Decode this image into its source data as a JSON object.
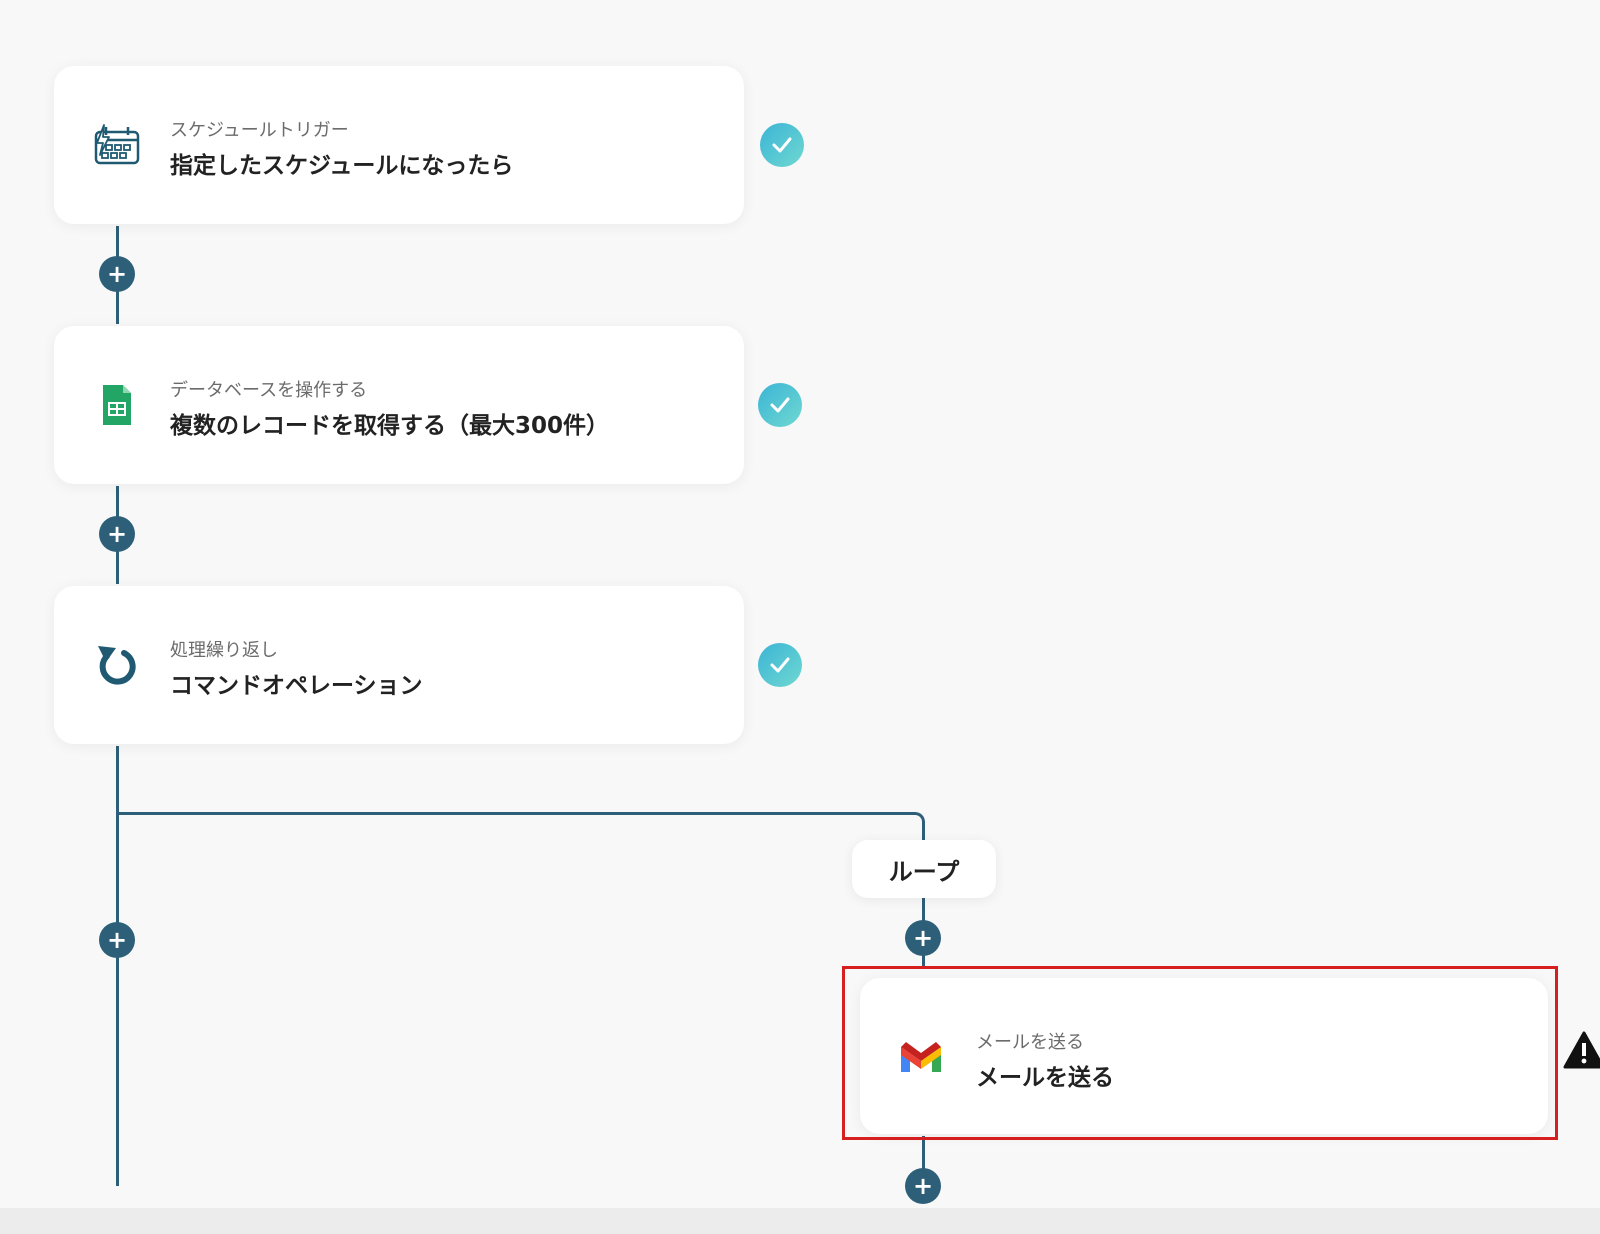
{
  "workflow": {
    "steps": [
      {
        "category": "スケジュールトリガー",
        "title": "指定したスケジュールになったら",
        "icon": "schedule-calendar-icon",
        "status": "complete"
      },
      {
        "category": "データベースを操作する",
        "title": "複数のレコードを取得する（最大300件）",
        "icon": "google-sheets-icon",
        "status": "complete"
      },
      {
        "category": "処理繰り返し",
        "title": "コマンドオペレーション",
        "icon": "loop-arrow-icon",
        "status": "complete"
      }
    ],
    "loop": {
      "label": "ループ",
      "steps": [
        {
          "category": "メールを送る",
          "title": "メールを送る",
          "icon": "gmail-icon",
          "status": "warning"
        }
      ]
    }
  },
  "colors": {
    "connector": "#2d5f78",
    "check_gradient_start": "#3bb4d6",
    "check_gradient_end": "#6fd8d0",
    "highlight_border": "#d61f1f",
    "background": "#f8f8f8"
  },
  "add_button_symbol": "+"
}
